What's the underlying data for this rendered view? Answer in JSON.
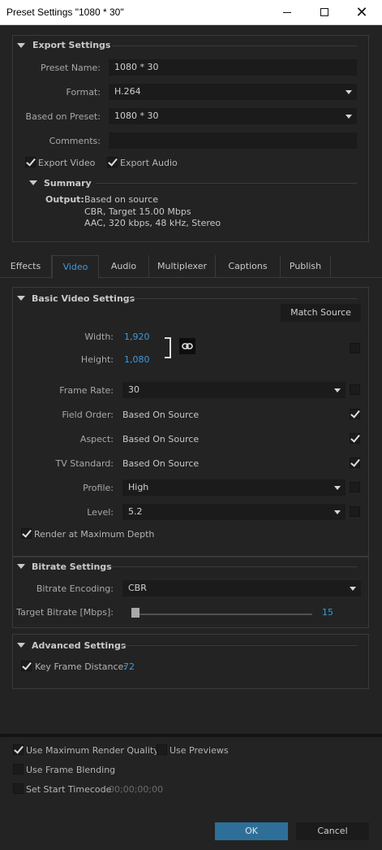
{
  "window": {
    "title": "Preset Settings \"1080 * 30\""
  },
  "export_settings": {
    "header": "Export Settings",
    "preset_name_label": "Preset Name:",
    "preset_name_value": "1080 * 30",
    "format_label": "Format:",
    "format_value": "H.264",
    "based_on_label": "Based on Preset:",
    "based_on_value": "1080 * 30",
    "comments_label": "Comments:",
    "comments_value": "",
    "export_video_label": "Export Video",
    "export_video_checked": true,
    "export_audio_label": "Export Audio",
    "export_audio_checked": true,
    "summary_header": "Summary",
    "output_label": "Output:",
    "output_lines": [
      "Based on source",
      "CBR, Target 15.00 Mbps",
      "AAC, 320 kbps, 48 kHz, Stereo"
    ]
  },
  "tabs": [
    {
      "label": "Effects",
      "active": false
    },
    {
      "label": "Video",
      "active": true
    },
    {
      "label": "Audio",
      "active": false
    },
    {
      "label": "Multiplexer",
      "active": false
    },
    {
      "label": "Captions",
      "active": false
    },
    {
      "label": "Publish",
      "active": false
    }
  ],
  "basic_video": {
    "header": "Basic Video Settings",
    "match_source": "Match Source",
    "width_label": "Width:",
    "width_value": "1,920",
    "height_label": "Height:",
    "height_value": "1,080",
    "frame_rate_label": "Frame Rate:",
    "frame_rate_value": "30",
    "field_order_label": "Field Order:",
    "field_order_value": "Based On Source",
    "aspect_label": "Aspect:",
    "aspect_value": "Based On Source",
    "tv_standard_label": "TV Standard:",
    "tv_standard_value": "Based On Source",
    "profile_label": "Profile:",
    "profile_value": "High",
    "level_label": "Level:",
    "level_value": "5.2",
    "render_max_depth_label": "Render at Maximum Depth"
  },
  "bitrate": {
    "header": "Bitrate Settings",
    "encoding_label": "Bitrate Encoding:",
    "encoding_value": "CBR",
    "target_label": "Target Bitrate [Mbps]:",
    "target_value": "15"
  },
  "advanced": {
    "header": "Advanced Settings",
    "key_frame_label": "Key Frame Distance:",
    "key_frame_value": "72"
  },
  "footer": {
    "max_render_quality": "Use Maximum Render Quality",
    "use_previews": "Use Previews",
    "frame_blending": "Use Frame Blending",
    "start_timecode_label": "Set Start Timecode",
    "start_timecode_value": "00;00;00;00",
    "ok": "OK",
    "cancel": "Cancel"
  },
  "colors": {
    "accent": "#3d9ad9",
    "ok_button": "#2d6f99",
    "background": "#232323"
  },
  "icons": [
    "close-icon",
    "minimize-icon",
    "maximize-icon",
    "link-icon",
    "chevron-down-icon",
    "collapse-triangle-icon",
    "checkmark-icon"
  ]
}
